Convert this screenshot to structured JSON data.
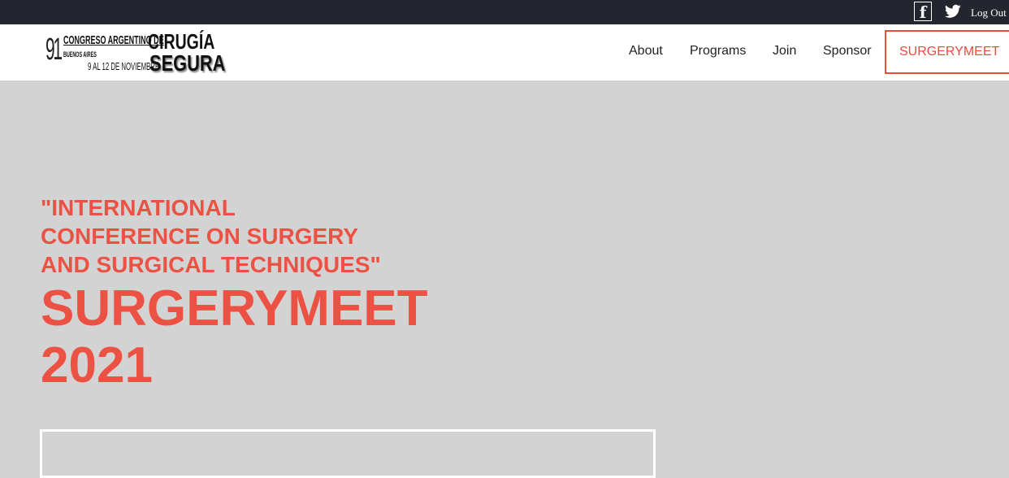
{
  "topbar": {
    "facebook_icon": "facebook-icon",
    "facebook_glyph": "f",
    "twitter_icon": "twitter-icon",
    "logout_label": "Log Out"
  },
  "logo": {
    "number": "91",
    "line1": "CONGRESO ARGENTINO DE",
    "word1": "CIRUGÍA",
    "line2": "BUENOS AIRES",
    "dates": "9 AL 12 DE NOVIEMBRE",
    "word2": "SEGURA"
  },
  "nav": {
    "items": [
      {
        "label": "About"
      },
      {
        "label": "Programs"
      },
      {
        "label": "Join"
      },
      {
        "label": "Sponsor"
      }
    ],
    "cta_label": "SURGERYMEET"
  },
  "hero": {
    "subtitle_line1": "\"INTERNATIONAL",
    "subtitle_line2": "CONFERENCE ON SURGERY",
    "subtitle_line3": "AND SURGICAL TECHNIQUES\"",
    "title_line1": "SURGERYMEET",
    "title_line2": "2021"
  },
  "colors": {
    "accent": "#ec5243",
    "topbar": "#23262e",
    "hero_bg": "#d3d3d3"
  }
}
